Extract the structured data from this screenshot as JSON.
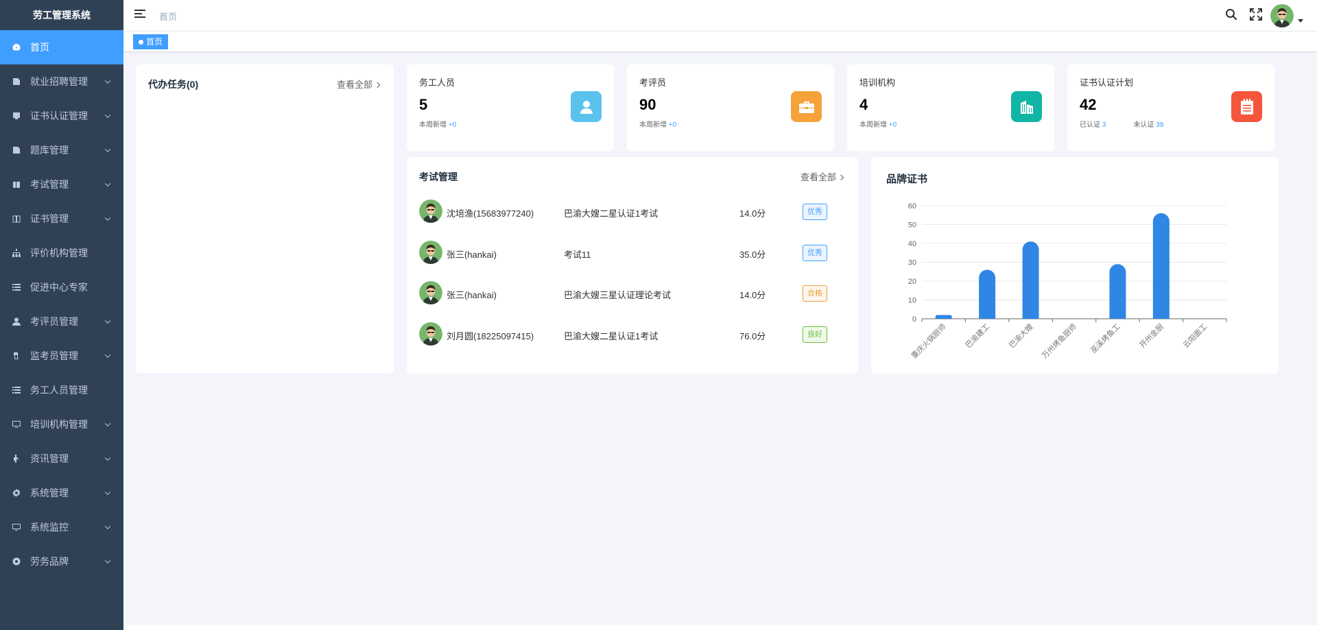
{
  "app": {
    "title": "劳工管理系统"
  },
  "sidebar": {
    "items": [
      {
        "label": "首页",
        "icon": "dashboard-icon",
        "expandable": false,
        "active": true
      },
      {
        "label": "就业招聘管理",
        "icon": "document-icon",
        "expandable": true
      },
      {
        "label": "证书认证管理",
        "icon": "certificate-icon",
        "expandable": true
      },
      {
        "label": "题库管理",
        "icon": "question-bank-icon",
        "expandable": true
      },
      {
        "label": "考试管理",
        "icon": "exam-icon",
        "expandable": true
      },
      {
        "label": "证书管理",
        "icon": "book-icon",
        "expandable": true
      },
      {
        "label": "评价机构管理",
        "icon": "org-tree-icon",
        "expandable": false
      },
      {
        "label": "促进中心专家",
        "icon": "list-icon",
        "expandable": false
      },
      {
        "label": "考评员管理",
        "icon": "user-icon",
        "expandable": true
      },
      {
        "label": "监考员管理",
        "icon": "proctor-icon",
        "expandable": true
      },
      {
        "label": "务工人员管理",
        "icon": "list-icon",
        "expandable": false
      },
      {
        "label": "培训机构管理",
        "icon": "monitor-icon",
        "expandable": true
      },
      {
        "label": "资讯管理",
        "icon": "news-icon",
        "expandable": true
      },
      {
        "label": "系统管理",
        "icon": "gear-icon",
        "expandable": true
      },
      {
        "label": "系统监控",
        "icon": "monitor-icon",
        "expandable": true
      },
      {
        "label": "劳务品牌",
        "icon": "brand-icon",
        "expandable": true
      }
    ]
  },
  "header": {
    "breadcrumb": "首页",
    "icons": [
      "search-icon",
      "fullscreen-icon"
    ]
  },
  "tags": [
    {
      "label": "首页",
      "active": true
    }
  ],
  "todo": {
    "title": "代办任务(0)",
    "view_all": "查看全部"
  },
  "stats": [
    {
      "label": "务工人员",
      "value": "5",
      "sub_prefix": "本周新增",
      "sub_value": "+0",
      "color": "#5bc2ee",
      "icon": "person-icon"
    },
    {
      "label": "考评员",
      "value": "90",
      "sub_prefix": "本周新增",
      "sub_value": "+0",
      "color": "#f6a23a",
      "icon": "briefcase-icon"
    },
    {
      "label": "培训机构",
      "value": "4",
      "sub_prefix": "本周新增",
      "sub_value": "+0",
      "color": "#10b5a5",
      "icon": "building-icon"
    },
    {
      "label": "证书认证计划",
      "value": "42",
      "sub_a_prefix": "已认证",
      "sub_a_value": "3",
      "sub_b_prefix": "未认证",
      "sub_b_value": "39",
      "color": "#f5553a",
      "icon": "clipboard-icon"
    }
  ],
  "exam": {
    "title": "考试管理",
    "view_all": "查看全部",
    "rows": [
      {
        "name": "沈培渔(15683977240)",
        "exam": "巴渝大嫂二星认证1考试",
        "score": "14.0分",
        "grade": "优秀",
        "grade_color": "blue"
      },
      {
        "name": "张三(hankai)",
        "exam": "考试11",
        "score": "35.0分",
        "grade": "优秀",
        "grade_color": "blue"
      },
      {
        "name": "张三(hankai)",
        "exam": "巴渝大嫂三星认证理论考试",
        "score": "14.0分",
        "grade": "合格",
        "grade_color": "yellow"
      },
      {
        "name": "刘月圆(18225097415)",
        "exam": "巴渝大嫂二星认证1考试",
        "score": "76.0分",
        "grade": "良好",
        "grade_color": "green"
      }
    ]
  },
  "brand": {
    "title": "品牌证书"
  },
  "chart_data": {
    "type": "bar",
    "title": "品牌证书",
    "categories": [
      "重庆火锅厨师",
      "巴渝建工",
      "巴渝大嫂",
      "万州烤鱼厨师",
      "巫溪烤鱼工",
      "开州金厨",
      "云阳面工"
    ],
    "values": [
      2,
      26,
      41,
      0,
      29,
      56,
      0
    ],
    "ylim": [
      0,
      60
    ],
    "yticks": [
      0,
      10,
      20,
      30,
      40,
      50,
      60
    ],
    "grid": true,
    "bar_color": "#2f86e5"
  }
}
